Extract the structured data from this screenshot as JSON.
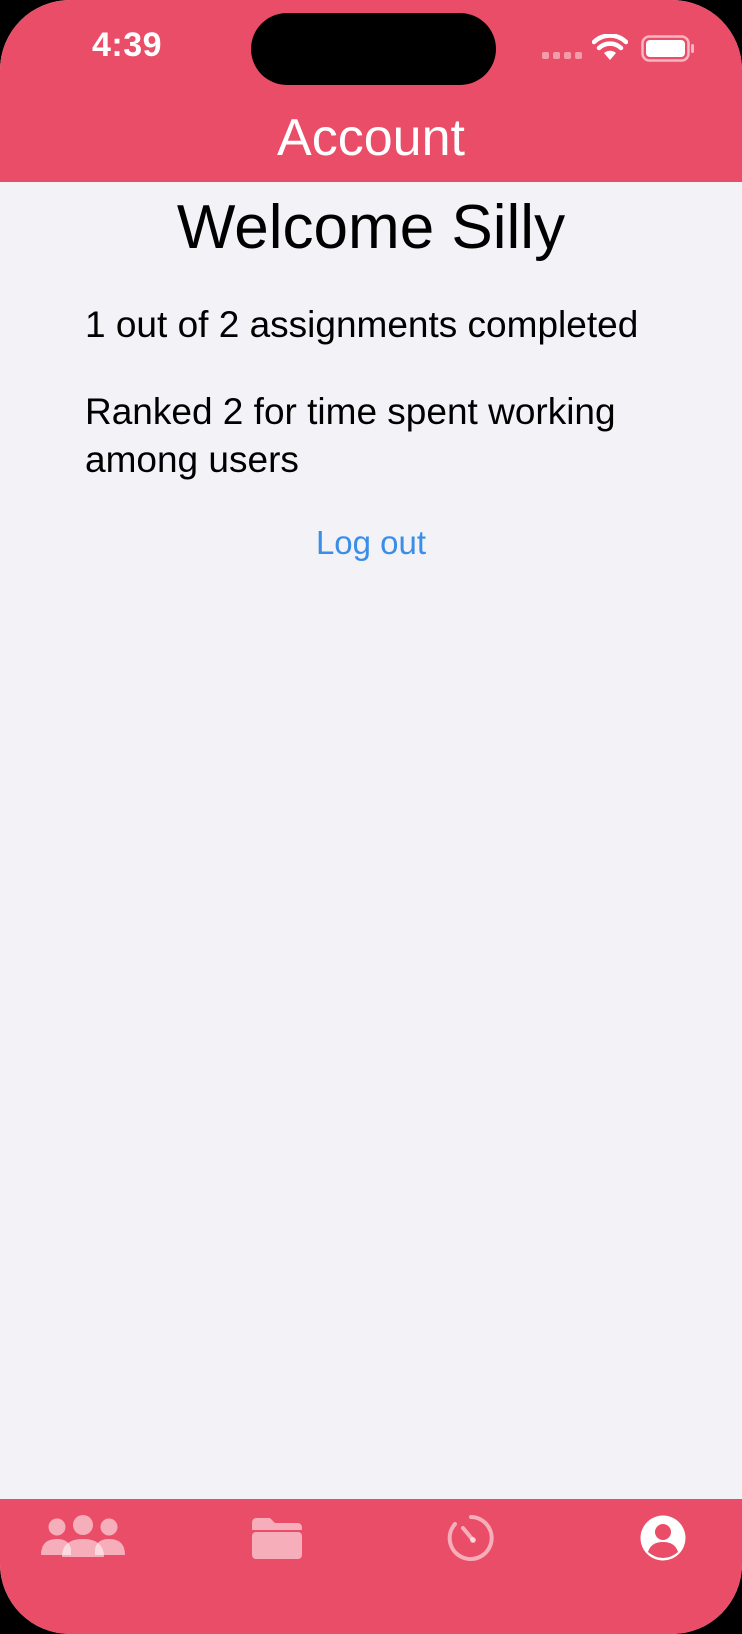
{
  "status_bar": {
    "time": "4:39"
  },
  "header": {
    "title": "Account"
  },
  "account": {
    "welcome": "Welcome Silly",
    "assignments_text": "1 out of 2 assignments completed",
    "ranking_text": "Ranked 2 for time spent working among users",
    "logout_label": "Log out"
  },
  "tabbar": {
    "tabs": [
      {
        "icon": "people-icon",
        "active": false
      },
      {
        "icon": "folder-icon",
        "active": false
      },
      {
        "icon": "timer-icon",
        "active": false
      },
      {
        "icon": "account-icon",
        "active": true
      }
    ]
  },
  "colors": {
    "accent": "#ea4d67",
    "background": "#f2f2f7",
    "link": "#3a8ee6"
  }
}
